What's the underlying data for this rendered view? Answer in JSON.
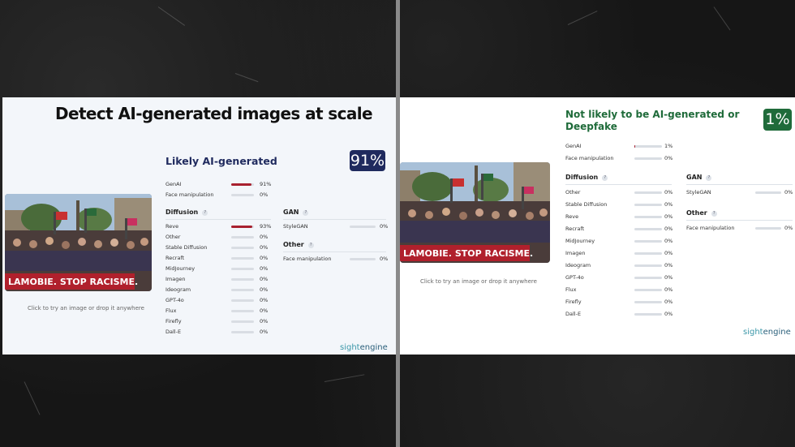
{
  "colors": {
    "bar_fill": "#a8212f",
    "track": "#d9dde3",
    "score_left": "#1f2a5e",
    "score_right": "#1f6b3a",
    "title_left": "#1f2a5e",
    "title_right": "#1f6b3a"
  },
  "left": {
    "headline": "Detect AI-generated images at scale",
    "caption": "Click to try an image or drop it anywhere",
    "result_title": "Likely AI-generated",
    "score": "91%",
    "top_rows": [
      {
        "label": "GenAI",
        "pct": "91%",
        "value": 0.91
      },
      {
        "label": "Face manipulation",
        "pct": "0%",
        "value": 0
      }
    ],
    "diffusion_title": "Diffusion",
    "diffusion_rows": [
      {
        "label": "Reve",
        "pct": "93%",
        "value": 0.93
      },
      {
        "label": "Other",
        "pct": "0%",
        "value": 0
      },
      {
        "label": "Stable Diffusion",
        "pct": "0%",
        "value": 0
      },
      {
        "label": "Recraft",
        "pct": "0%",
        "value": 0
      },
      {
        "label": "MidJourney",
        "pct": "0%",
        "value": 0
      },
      {
        "label": "Imagen",
        "pct": "0%",
        "value": 0
      },
      {
        "label": "Ideogram",
        "pct": "0%",
        "value": 0
      },
      {
        "label": "GPT-4o",
        "pct": "0%",
        "value": 0
      },
      {
        "label": "Flux",
        "pct": "0%",
        "value": 0
      },
      {
        "label": "Firefly",
        "pct": "0%",
        "value": 0
      },
      {
        "label": "Dall-E",
        "pct": "0%",
        "value": 0
      }
    ],
    "gan_title": "GAN",
    "gan_rows": [
      {
        "label": "StyleGAN",
        "pct": "0%",
        "value": 0
      }
    ],
    "other_title": "Other",
    "other_rows": [
      {
        "label": "Face manipulation",
        "pct": "0%",
        "value": 0
      }
    ],
    "brand_a": "sight",
    "brand_b": "engine"
  },
  "right": {
    "caption": "Click to try an image or drop it anywhere",
    "result_title": "Not likely to be AI-generated or Deepfake",
    "score": "1%",
    "top_rows": [
      {
        "label": "GenAI",
        "pct": "1%",
        "value": 0.01
      },
      {
        "label": "Face manipulation",
        "pct": "0%",
        "value": 0
      }
    ],
    "diffusion_title": "Diffusion",
    "diffusion_rows": [
      {
        "label": "Other",
        "pct": "0%",
        "value": 0
      },
      {
        "label": "Stable Diffusion",
        "pct": "0%",
        "value": 0
      },
      {
        "label": "Reve",
        "pct": "0%",
        "value": 0
      },
      {
        "label": "Recraft",
        "pct": "0%",
        "value": 0
      },
      {
        "label": "MidJourney",
        "pct": "0%",
        "value": 0
      },
      {
        "label": "Imagen",
        "pct": "0%",
        "value": 0
      },
      {
        "label": "Ideogram",
        "pct": "0%",
        "value": 0
      },
      {
        "label": "GPT-4o",
        "pct": "0%",
        "value": 0
      },
      {
        "label": "Flux",
        "pct": "0%",
        "value": 0
      },
      {
        "label": "Firefly",
        "pct": "0%",
        "value": 0
      },
      {
        "label": "Dall-E",
        "pct": "0%",
        "value": 0
      }
    ],
    "gan_title": "GAN",
    "gan_rows": [
      {
        "label": "StyleGAN",
        "pct": "0%",
        "value": 0
      }
    ],
    "other_title": "Other",
    "other_rows": [
      {
        "label": "Face manipulation",
        "pct": "0%",
        "value": 0
      }
    ],
    "brand_a": "sight",
    "brand_b": "engine",
    "banner_text": "LAMOBIE. STOP RACISME."
  },
  "left_banner_text": "LAMOBIE. STOP RACISME."
}
